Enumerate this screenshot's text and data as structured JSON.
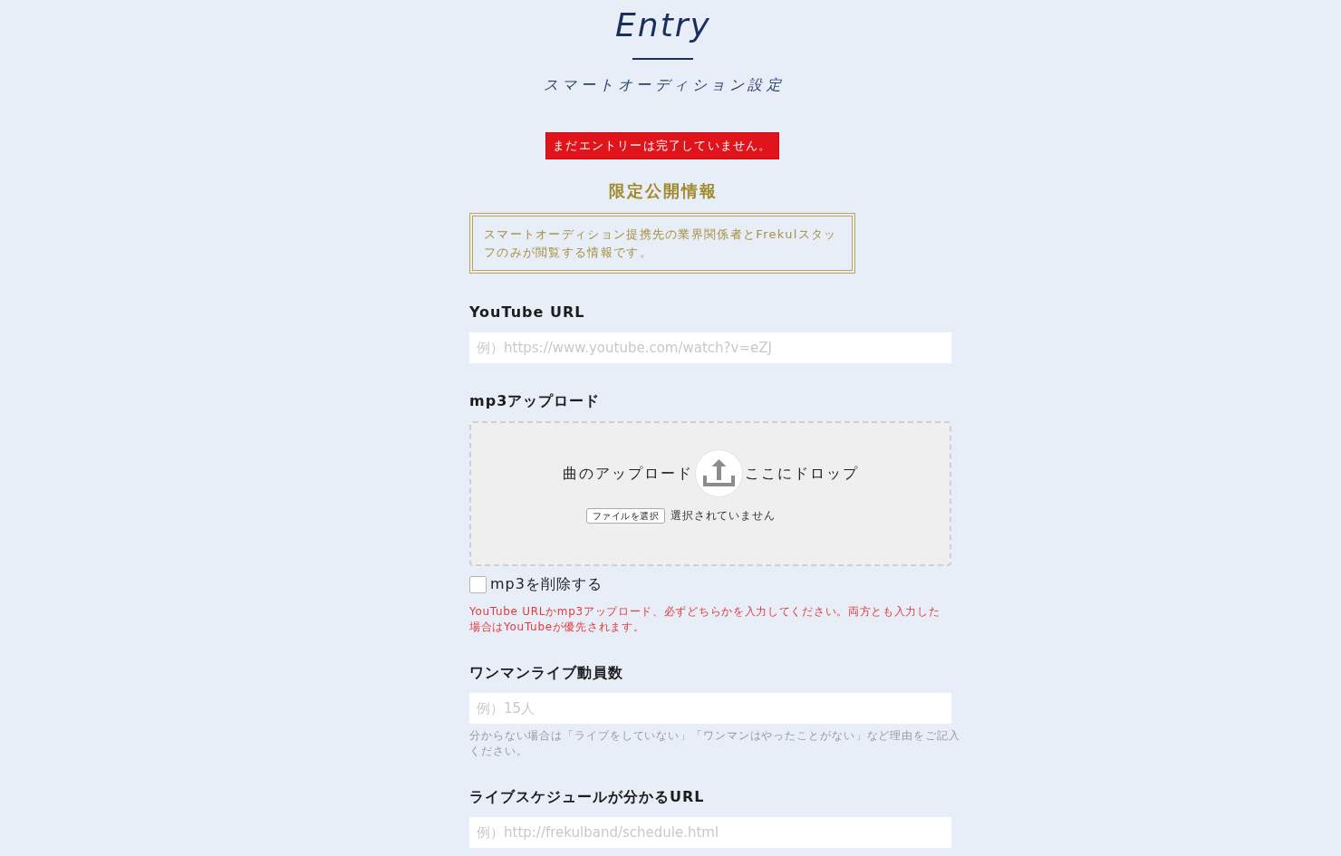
{
  "header": {
    "title": "Entry",
    "subtitle": "スマートオーディション設定"
  },
  "status_banner": "まだエントリーは完了していません。",
  "notice": {
    "heading": "限定公開情報",
    "text": "スマートオーディション提携先の業界関係者とFrekulスタッフのみが閲覧する情報です。"
  },
  "fields": [
    {
      "kind": "text",
      "label": "YouTube URL",
      "placeholder": "例）https://www.youtube.com/watch?v=eZJ"
    },
    {
      "kind": "upload",
      "label": "mp3アップロード",
      "drop_text_before": "曲のアップロード",
      "drop_text_after": "ここにドロップ",
      "file_button": "ファイルを選択",
      "file_status": "選択されていません",
      "delete_option": {
        "label": "mp3を削除する",
        "checked": false
      },
      "note": "YouTube URLかmp3アップロード、必ずどちらかを入力してください。両方とも入力した場合はYouTubeが優先されます。"
    },
    {
      "kind": "text",
      "label": "ワンマンライブ動員数",
      "placeholder": "例）15人",
      "hint": "分からない場合は「ライブをしていない」「ワンマンはやったことがない」など理由をご記入ください。"
    },
    {
      "kind": "text",
      "label": "ライブスケジュールが分かるURL",
      "placeholder": "例）http://frekulband/schedule.html"
    }
  ]
}
